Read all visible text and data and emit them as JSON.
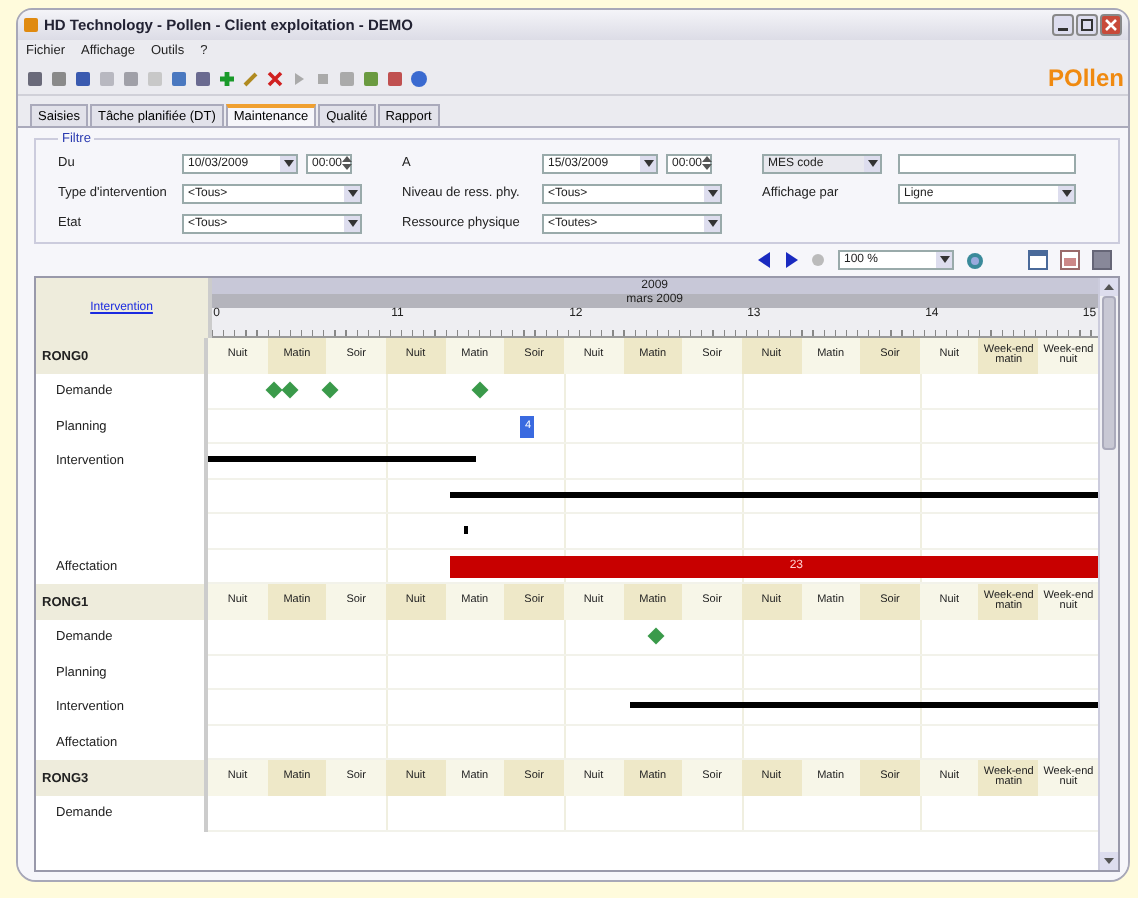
{
  "window": {
    "title": "HD Technology - Pollen - Client exploitation - DEMO"
  },
  "menu": [
    "Fichier",
    "Affichage",
    "Outils",
    "?"
  ],
  "logo": "POllen",
  "tabs": [
    {
      "label": "Saisies",
      "selected": false
    },
    {
      "label": "Tâche planifiée (DT)",
      "selected": false
    },
    {
      "label": "Maintenance",
      "selected": true
    },
    {
      "label": "Qualité",
      "selected": false
    },
    {
      "label": "Rapport",
      "selected": false
    }
  ],
  "filter": {
    "legend": "Filtre",
    "rows": [
      [
        {
          "kind": "label",
          "text": "Du"
        },
        {
          "kind": "datetime",
          "date": "10/03/2009",
          "time": "00:00"
        },
        {
          "kind": "label",
          "text": "A"
        },
        {
          "kind": "datetime",
          "date": "15/03/2009",
          "time": "00:00"
        },
        {
          "kind": "select",
          "value": "MES code"
        },
        {
          "kind": "text"
        }
      ],
      [
        {
          "kind": "label",
          "text": "Type d'intervention"
        },
        {
          "kind": "combo",
          "value": "<Tous>"
        },
        {
          "kind": "label",
          "text": "Niveau de ress. phy."
        },
        {
          "kind": "combo",
          "value": "<Tous>"
        },
        {
          "kind": "label",
          "text": "Affichage par"
        },
        {
          "kind": "combo",
          "value": "Ligne"
        }
      ],
      [
        {
          "kind": "label",
          "text": "Etat"
        },
        {
          "kind": "combo",
          "value": "<Tous>"
        },
        {
          "kind": "label",
          "text": "Ressource physique"
        },
        {
          "kind": "combo",
          "value": "<Toutes>"
        }
      ]
    ]
  },
  "zoom": {
    "value": "100 %"
  },
  "gantt": {
    "column_header": "Intervention",
    "year": "2009",
    "month": "mars 2009",
    "days": [
      "0",
      "11",
      "12",
      "13",
      "14",
      "15"
    ],
    "groups": [
      {
        "name": "RONG0",
        "shifts": [
          {
            "label": "Nuit",
            "kind": "shift",
            "shaded": false
          },
          {
            "label": "Matin",
            "kind": "shift",
            "shaded": true
          },
          {
            "label": "Soir",
            "kind": "shift",
            "shaded": false
          },
          {
            "label": "Nuit",
            "kind": "shift",
            "shaded": true
          },
          {
            "label": "Matin",
            "kind": "shift",
            "shaded": false
          },
          {
            "label": "Soir",
            "kind": "shift",
            "shaded": true
          },
          {
            "label": "Nuit",
            "kind": "shift",
            "shaded": false
          },
          {
            "label": "Matin",
            "kind": "shift",
            "shaded": true
          },
          {
            "label": "Soir",
            "kind": "shift",
            "shaded": false
          },
          {
            "label": "Nuit",
            "kind": "shift",
            "shaded": true
          },
          {
            "label": "Matin",
            "kind": "shift",
            "shaded": false
          },
          {
            "label": "Soir",
            "kind": "shift",
            "shaded": true
          },
          {
            "label": "Nuit",
            "kind": "shift",
            "shaded": false
          },
          {
            "label": "Week-end matin",
            "kind": "weekend",
            "shaded": true
          },
          {
            "label": "Week-end nuit",
            "kind": "weekend",
            "shaded": false
          }
        ],
        "rows": [
          {
            "label": "Demande",
            "marks": [
              {
                "kind": "diamond"
              },
              {
                "kind": "diamond"
              },
              {
                "kind": "diamond"
              },
              {
                "kind": "diamond"
              }
            ]
          },
          {
            "label": "Planning",
            "marks": [
              {
                "kind": "box",
                "label": "4"
              }
            ]
          },
          {
            "label": "Intervention",
            "marks": [
              {
                "kind": "bar"
              }
            ]
          },
          {
            "marks": [
              {
                "kind": "bar"
              }
            ]
          },
          {
            "marks": [
              {
                "kind": "dot"
              }
            ]
          },
          {
            "label": "Affectation",
            "marks": [
              {
                "kind": "redbar",
                "label": "23"
              }
            ]
          }
        ]
      },
      {
        "name": "RONG1",
        "shifts": [
          {
            "label": "Nuit",
            "kind": "shift",
            "shaded": false
          },
          {
            "label": "Matin",
            "kind": "shift",
            "shaded": true
          },
          {
            "label": "Soir",
            "kind": "shift",
            "shaded": false
          },
          {
            "label": "Nuit",
            "kind": "shift",
            "shaded": true
          },
          {
            "label": "Matin",
            "kind": "shift",
            "shaded": false
          },
          {
            "label": "Soir",
            "kind": "shift",
            "shaded": true
          },
          {
            "label": "Nuit",
            "kind": "shift",
            "shaded": false
          },
          {
            "label": "Matin",
            "kind": "shift",
            "shaded": true
          },
          {
            "label": "Soir",
            "kind": "shift",
            "shaded": false
          },
          {
            "label": "Nuit",
            "kind": "shift",
            "shaded": true
          },
          {
            "label": "Matin",
            "kind": "shift",
            "shaded": false
          },
          {
            "label": "Soir",
            "kind": "shift",
            "shaded": true
          },
          {
            "label": "Nuit",
            "kind": "shift",
            "shaded": false
          },
          {
            "label": "Week-end matin",
            "kind": "weekend",
            "shaded": true
          },
          {
            "label": "Week-end nuit",
            "kind": "weekend",
            "shaded": false
          }
        ],
        "rows": [
          {
            "label": "Demande",
            "marks": [
              {
                "kind": "diamond"
              }
            ]
          },
          {
            "label": "Planning",
            "marks": []
          },
          {
            "label": "Intervention",
            "marks": [
              {
                "kind": "bar"
              }
            ]
          },
          {
            "label": "Affectation",
            "marks": []
          }
        ]
      },
      {
        "name": "RONG3",
        "shifts": [
          {
            "label": "Nuit",
            "kind": "shift",
            "shaded": false
          },
          {
            "label": "Matin",
            "kind": "shift",
            "shaded": true
          },
          {
            "label": "Soir",
            "kind": "shift",
            "shaded": false
          },
          {
            "label": "Nuit",
            "kind": "shift",
            "shaded": true
          },
          {
            "label": "Matin",
            "kind": "shift",
            "shaded": false
          },
          {
            "label": "Soir",
            "kind": "shift",
            "shaded": true
          },
          {
            "label": "Nuit",
            "kind": "shift",
            "shaded": false
          },
          {
            "label": "Matin",
            "kind": "shift",
            "shaded": true
          },
          {
            "label": "Soir",
            "kind": "shift",
            "shaded": false
          },
          {
            "label": "Nuit",
            "kind": "shift",
            "shaded": true
          },
          {
            "label": "Matin",
            "kind": "shift",
            "shaded": false
          },
          {
            "label": "Soir",
            "kind": "shift",
            "shaded": true
          },
          {
            "label": "Nuit",
            "kind": "shift",
            "shaded": false
          },
          {
            "label": "Week-end matin",
            "kind": "weekend",
            "shaded": true
          },
          {
            "label": "Week-end nuit",
            "kind": "weekend",
            "shaded": false
          }
        ],
        "rows": [
          {
            "label": "Demande",
            "marks": []
          }
        ]
      }
    ]
  }
}
